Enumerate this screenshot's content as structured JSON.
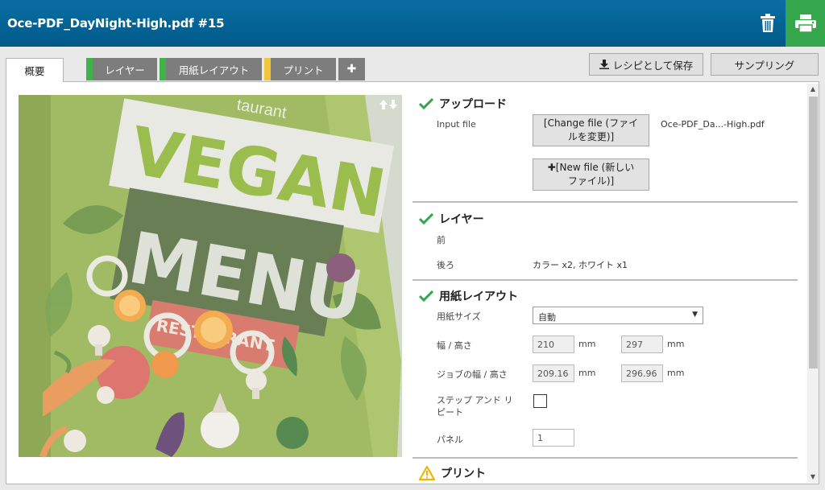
{
  "header": {
    "title": "Oce-PDF_DayNight-High.pdf #15"
  },
  "tabs": {
    "overview": "概要",
    "layers": "レイヤー",
    "paper_layout": "用紙レイアウト",
    "print": "プリント",
    "add": "✚"
  },
  "toolbar": {
    "save_recipe": "レシピとして保存",
    "sampling": "サンプリング"
  },
  "colors": {
    "header": "#005a8a",
    "print_button": "#34a64b",
    "status_ok": "#34a64b",
    "status_warn": "#f0b400",
    "tab_stripe_green": "#3fb24a",
    "tab_stripe_yellow": "#f2c53a"
  },
  "preview": {
    "text_vegan": "VEGAN",
    "text_menu": "MENU",
    "text_restaurant": "RESTAURANT",
    "text_top": "taurant"
  },
  "upload": {
    "title": "アップロード",
    "input_file_label": "Input file",
    "change_file_line1": "[Change file (ファイ",
    "change_file_line2": "ルを変更)]",
    "file_name": "Oce-PDF_Da...-High.pdf",
    "new_file_line1": "[New file (新しい",
    "new_file_line2": "ファイル)]"
  },
  "layers": {
    "title": "レイヤー",
    "front_label": "前",
    "back_label": "後ろ",
    "back_value": "カラー x2, ホワイト x1"
  },
  "paper_layout": {
    "title": "用紙レイアウト",
    "paper_size_label": "用紙サイズ",
    "paper_size_value": "自動",
    "width_height_label": "幅 / 高さ",
    "width": "210",
    "height": "297",
    "unit": "mm",
    "job_size_label": "ジョブの幅 / 高さ",
    "job_width": "209.16",
    "job_height": "296.96",
    "step_repeat_line1": "ステップ アンド リ",
    "step_repeat_line2": "ピート",
    "panels_label": "パネル",
    "panels_value": "1"
  },
  "print": {
    "title": "プリント"
  }
}
